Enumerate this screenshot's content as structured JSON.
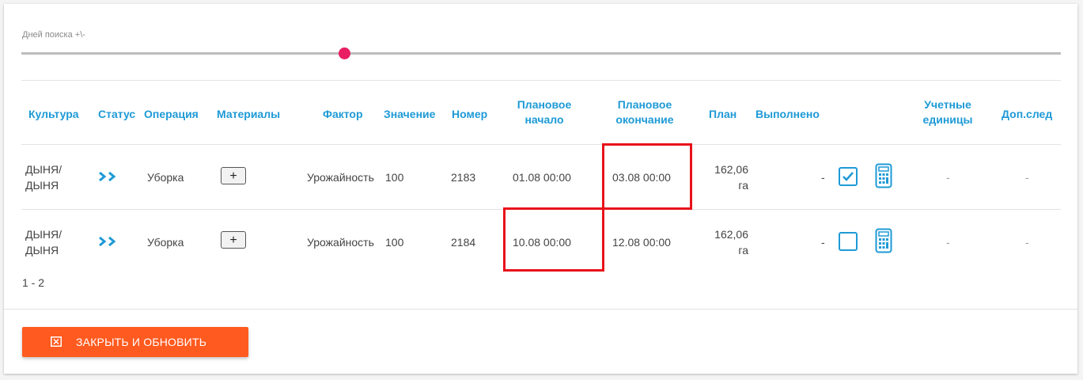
{
  "slider": {
    "label": "Дней поиска +\\-"
  },
  "table": {
    "headers": {
      "culture": "Культура",
      "status": "Статус",
      "operation": "Операция",
      "materials": "Материалы",
      "factor": "Фактор",
      "value": "Значение",
      "number": "Номер",
      "plan_start_1": "Плановое",
      "plan_start_2": "начало",
      "plan_end_1": "Плановое",
      "plan_end_2": "окончание",
      "plan": "План",
      "done": "Выполнено",
      "units_1": "Учетные",
      "units_2": "единицы",
      "extra": "Доп.след"
    },
    "rows": [
      {
        "culture_1": "ДЫНЯ/",
        "culture_2": "ДЫНЯ",
        "operation": "Уборка",
        "materials_btn": "+",
        "factor": "Урожайность",
        "value": "100",
        "number": "2183",
        "plan_start": "01.08 00:00",
        "plan_end": "03.08 00:00",
        "plan_1": "162,06",
        "plan_2": "га",
        "done": "-",
        "checked": true,
        "units": "-",
        "extra": "-"
      },
      {
        "culture_1": "ДЫНЯ/",
        "culture_2": "ДЫНЯ",
        "operation": "Уборка",
        "materials_btn": "+",
        "factor": "Урожайность",
        "value": "100",
        "number": "2184",
        "plan_start": "10.08 00:00",
        "plan_end": "12.08 00:00",
        "plan_1": "162,06",
        "plan_2": "га",
        "done": "-",
        "checked": false,
        "units": "-",
        "extra": "-"
      }
    ]
  },
  "pager": {
    "text": "1 - 2"
  },
  "footer": {
    "close_label": "ЗАКРЫТЬ И ОБНОВИТЬ"
  },
  "colors": {
    "accent": "#1e9ad6",
    "slider_thumb": "#e91e63",
    "button": "#ff5a1f",
    "highlight": "#e8111a"
  }
}
